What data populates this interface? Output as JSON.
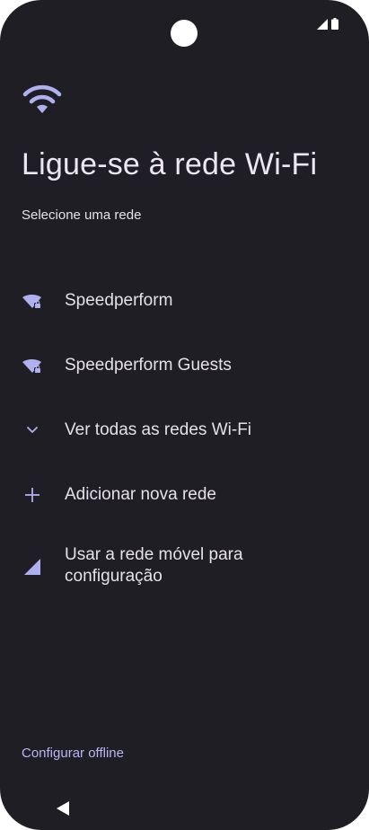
{
  "status_bar": {
    "icons": [
      "signal-icon",
      "battery-icon"
    ]
  },
  "header": {
    "icon": "wifi-icon",
    "title": "Ligue-se à rede Wi-Fi",
    "subtitle": "Selecione uma rede"
  },
  "networks": [
    {
      "name": "Speedperform",
      "icon": "wifi-locked-icon"
    },
    {
      "name": "Speedperform Guests",
      "icon": "wifi-locked-icon"
    }
  ],
  "actions": {
    "see_all": "Ver todas as redes Wi-Fi",
    "add_network": "Adicionar nova rede",
    "mobile_line1": "Usar a rede móvel para",
    "mobile_line2": "configuração"
  },
  "footer": {
    "offline_label": "Configurar offline"
  },
  "nav": {
    "back_icon": "back-triangle-icon"
  },
  "colors": {
    "background": "#1f1e25",
    "accent": "#b9b6f5",
    "icon_purple": "#aeb0f0",
    "text": "#e6e1e9"
  }
}
